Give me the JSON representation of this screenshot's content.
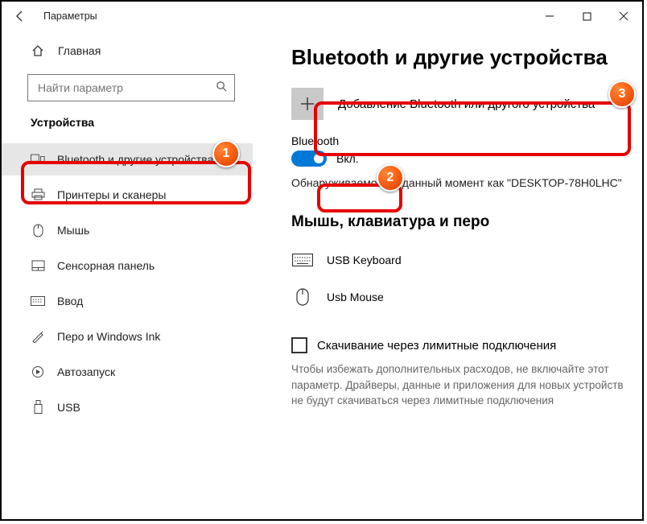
{
  "window": {
    "app_title": "Параметры"
  },
  "sidebar": {
    "home_label": "Главная",
    "search_placeholder": "Найти параметр",
    "group_title": "Устройства",
    "items": [
      {
        "label": "Bluetooth и другие устройства"
      },
      {
        "label": "Принтеры и сканеры"
      },
      {
        "label": "Мышь"
      },
      {
        "label": "Сенсорная панель"
      },
      {
        "label": "Ввод"
      },
      {
        "label": "Перо и Windows Ink"
      },
      {
        "label": "Автозапуск"
      },
      {
        "label": "USB"
      }
    ]
  },
  "page": {
    "title": "Bluetooth и другие устройства",
    "add_device_label": "Добавление Bluetooth или другого устройства",
    "bt_section_label": "Bluetooth",
    "bt_toggle_state": "Вкл.",
    "discover_text": "Обнаруживаемое на данный момент как \"DESKTOP-78H0LHC\"",
    "input_devices_title": "Мышь, клавиатура и перо",
    "devices": [
      {
        "label": "USB Keyboard"
      },
      {
        "label": "Usb Mouse"
      }
    ],
    "metered_checkbox_label": "Скачивание через лимитные подключения",
    "metered_desc": "Чтобы избежать дополнительных расходов, не включайте этот параметр. Драйверы, данные и приложения для новых устройств не будут скачиваться через лимитные подключения"
  },
  "annotations": {
    "b1": "1",
    "b2": "2",
    "b3": "3"
  }
}
